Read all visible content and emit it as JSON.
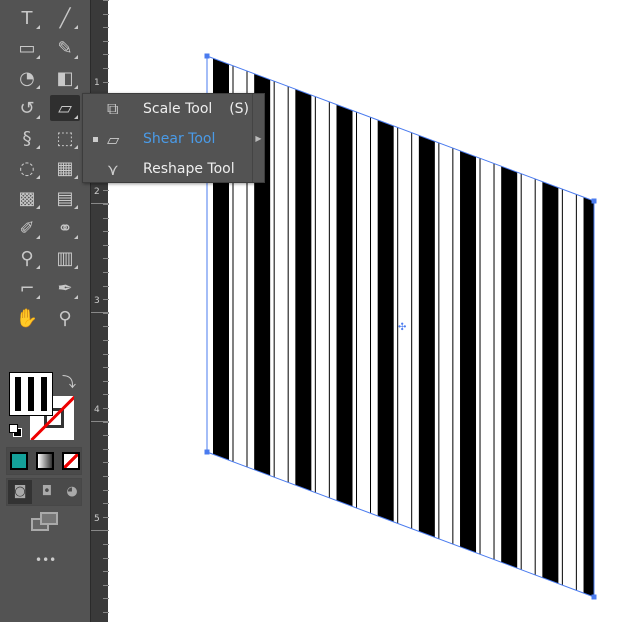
{
  "toolbar": {
    "tools": [
      "type-tool",
      "line-tool",
      "rectangle-tool",
      "shaper-tool",
      "blob-brush-tool",
      "eraser-tool",
      "rotate-tool",
      "shear-tool",
      "puppet-warp-tool",
      "free-transform-tool",
      "shape-builder-tool",
      "perspective-grid-tool",
      "mesh-tool",
      "gradient-tool",
      "eyedropper-tool",
      "blend-tool",
      "symbol-sprayer-tool",
      "graph-tool",
      "artboard-tool",
      "slice-tool",
      "hand-tool",
      "zoom-tool"
    ],
    "more_label": "•••"
  },
  "flyout": {
    "items": [
      {
        "label": "Scale Tool",
        "shortcut": "(S)",
        "icon": "scale-icon"
      },
      {
        "label": "Shear Tool",
        "shortcut": "",
        "icon": "shear-icon",
        "selected": true
      },
      {
        "label": "Reshape Tool",
        "shortcut": "",
        "icon": "reshape-icon"
      }
    ]
  },
  "ruler": {
    "labels": [
      "1",
      "2",
      "3",
      "4",
      "5"
    ]
  },
  "colors": {
    "accent": "#4a9be8",
    "fill_mode_color": "#14a19a",
    "selection": "#4a7bef"
  },
  "artwork": {
    "stripes": 10
  }
}
